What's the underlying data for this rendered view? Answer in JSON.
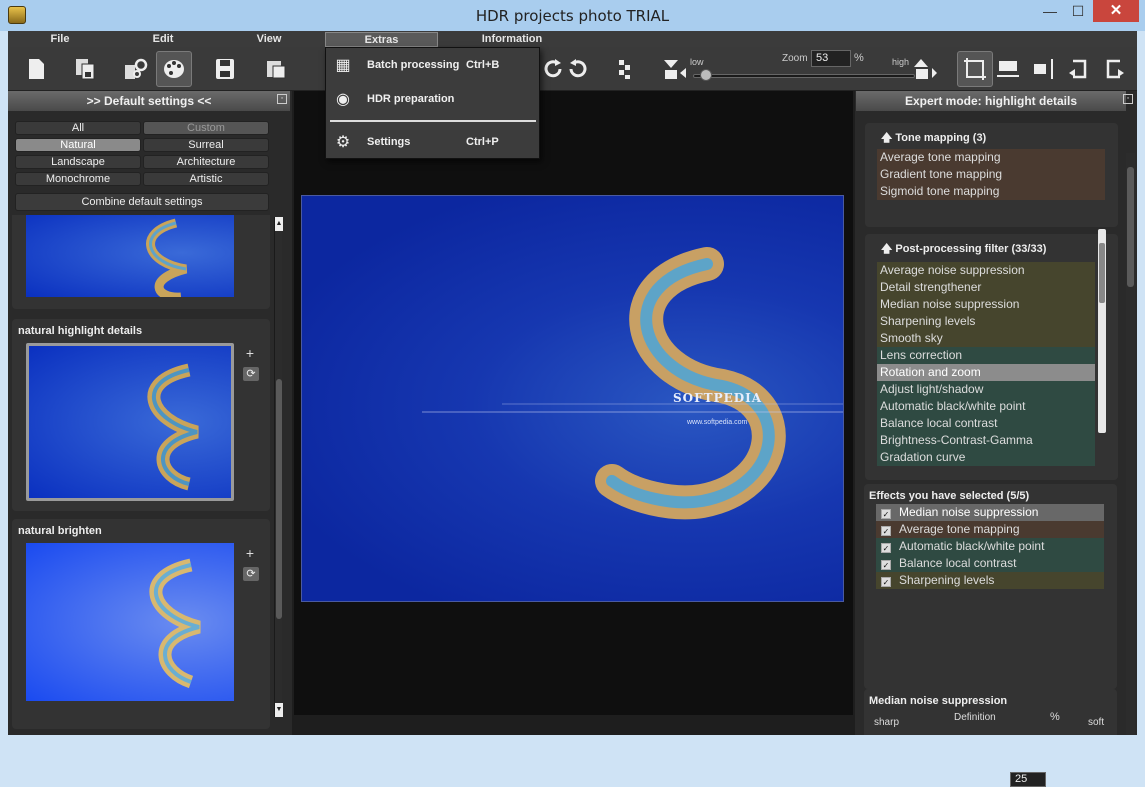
{
  "window": {
    "title": "HDR projects photo  TRIAL",
    "min": "—",
    "max": "☐",
    "close": "✕"
  },
  "menus": [
    "File",
    "Edit",
    "View",
    "Extras",
    "Information"
  ],
  "toolbar": {
    "zoom_low": "low",
    "zoom_label": "Zoom",
    "zoom_value": "53",
    "zoom_pct": "%",
    "zoom_high": "high",
    "zoom_level_percent": 53
  },
  "dropdown": [
    {
      "label": "Batch processing",
      "shortcut": "Ctrl+B"
    },
    {
      "label": "HDR preparation",
      "shortcut": ""
    },
    {
      "label": "Settings",
      "shortcut": "Ctrl+P"
    }
  ],
  "left": {
    "header": ">> Default settings <<",
    "categories": [
      "All",
      "Custom",
      "Natural",
      "Surreal",
      "Landscape",
      "Architecture",
      "Monochrome",
      "Artistic"
    ],
    "combine": "Combine default settings",
    "preset_1": "natural highlight details",
    "preset_2": "natural brighten",
    "plus": "+",
    "refresh": "⟳"
  },
  "image": {
    "watermark": "SOFTPEDIA",
    "watermark_url": "www.softpedia.com"
  },
  "right": {
    "header": "Expert mode: highlight details",
    "tone_title": "Tone mapping (3)",
    "tone": [
      "Average tone mapping",
      "Gradient tone mapping",
      "Sigmoid tone mapping"
    ],
    "pp_title": "Post-processing filter (33/33)",
    "pp": [
      "Average noise suppression",
      "Detail strengthener",
      "Median noise suppression",
      "Sharpening levels",
      "Smooth sky",
      "Lens correction",
      "Rotation and zoom",
      "Adjust light/shadow",
      "Automatic black/white point",
      "Balance local contrast",
      "Brightness-Contrast-Gamma",
      "Gradation curve"
    ],
    "fx_title": "Effects you have selected (5/5)",
    "fx": [
      "Median noise suppression",
      "Average tone mapping",
      "Automatic black/white point",
      "Balance local contrast",
      "Sharpening levels"
    ],
    "param_title": "Median noise suppression",
    "sharp": "sharp",
    "definition": "Definition",
    "def_value": "25",
    "pct": "%",
    "soft": "soft"
  },
  "colors": {
    "tone_bg": "#4a3a30",
    "pp_olive": "#46452d",
    "pp_teal": "#2f4a42",
    "pp_selected": "#8c8c8c",
    "fx_selected": "#686868"
  }
}
